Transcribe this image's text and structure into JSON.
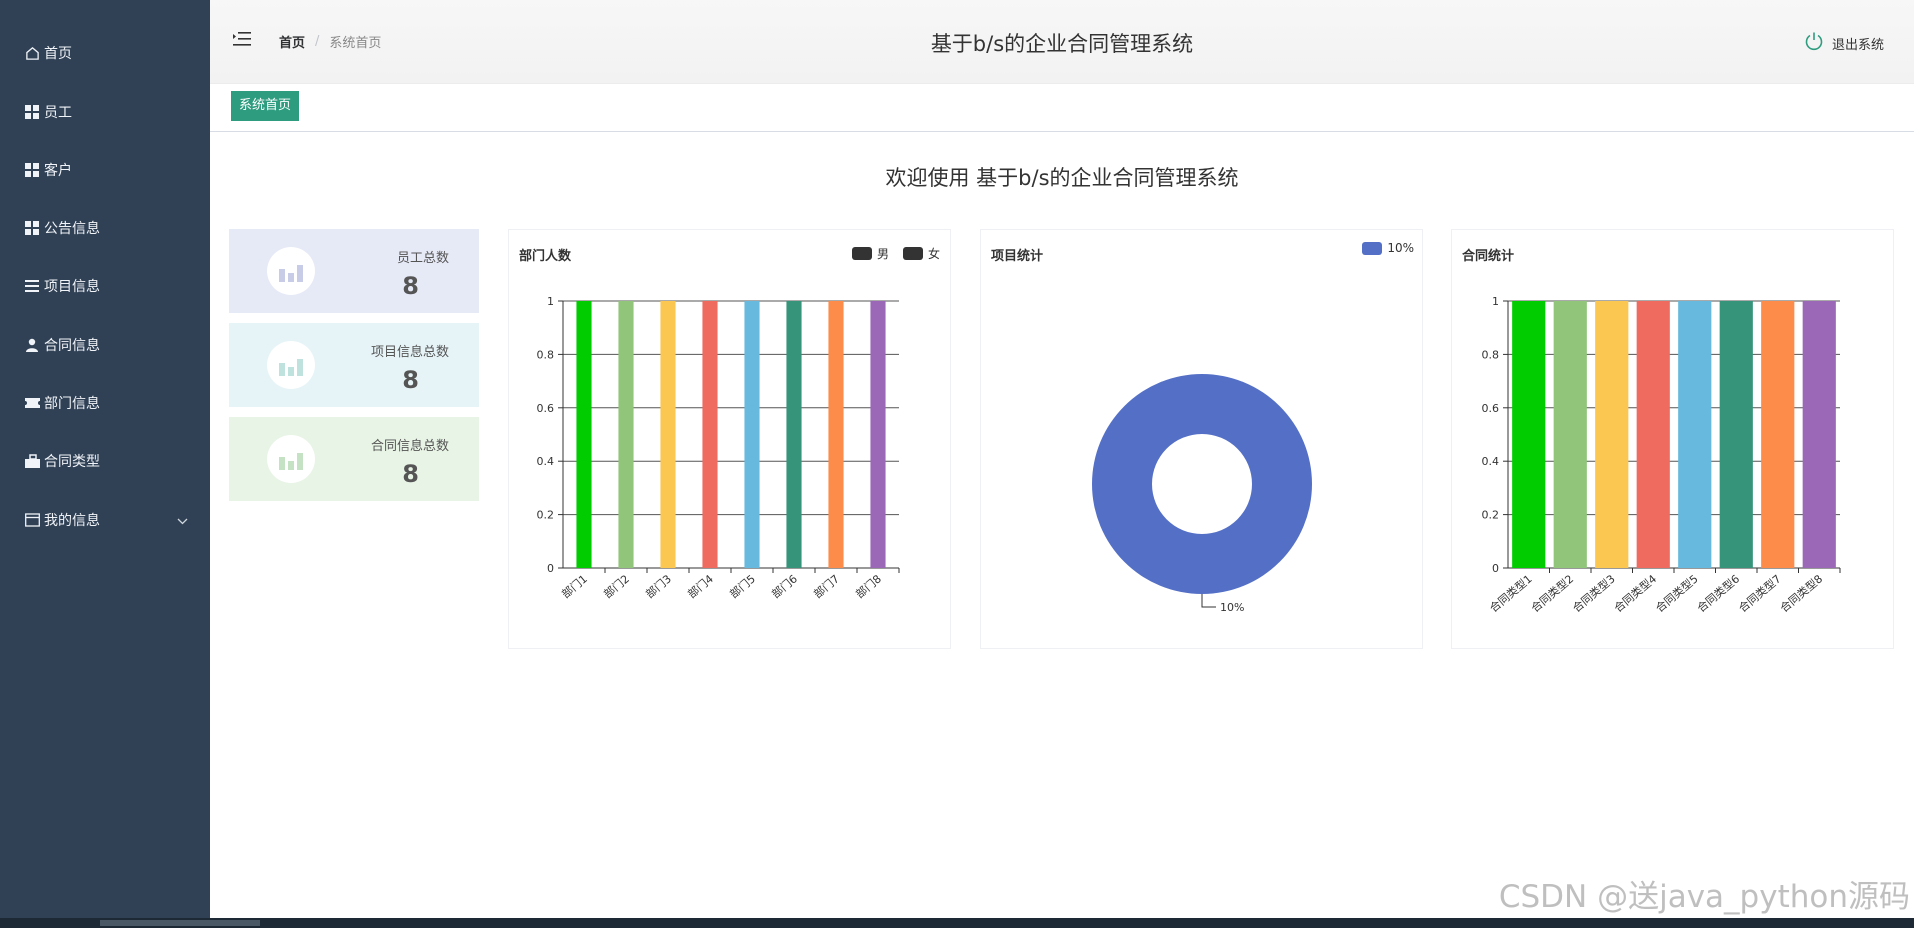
{
  "sidebar": {
    "items": [
      {
        "label": "首页",
        "icon": "home-icon"
      },
      {
        "label": "员工",
        "icon": "grid-icon"
      },
      {
        "label": "客户",
        "icon": "grid-icon"
      },
      {
        "label": "公告信息",
        "icon": "grid-icon"
      },
      {
        "label": "项目信息",
        "icon": "list-icon"
      },
      {
        "label": "合同信息",
        "icon": "user-icon"
      },
      {
        "label": "部门信息",
        "icon": "ticket-icon"
      },
      {
        "label": "合同类型",
        "icon": "briefcase-icon"
      },
      {
        "label": "我的信息",
        "icon": "window-icon"
      }
    ]
  },
  "header": {
    "breadcrumb": [
      "首页",
      "系统首页"
    ],
    "title": "基于b/s的企业合同管理系统",
    "logout_label": "退出系统"
  },
  "tags": {
    "active": "系统首页"
  },
  "welcome": "欢迎使用 基于b/s的企业合同管理系统",
  "stats": [
    {
      "label": "员工总数",
      "value": "8",
      "bg": "#e6e9f6"
    },
    {
      "label": "项目信息总数",
      "value": "8",
      "bg": "#e6f4f8"
    },
    {
      "label": "合同信息总数",
      "value": "8",
      "bg": "#e8f4e6"
    }
  ],
  "colors": {
    "sidebar_bg": "#304156",
    "accent": "#2e9c7f",
    "palette": [
      "#00cc00",
      "#91c57a",
      "#fcc751",
      "#ef6b5f",
      "#67b9de",
      "#35947a",
      "#fd8b4a",
      "#9b68b8"
    ]
  },
  "chart_data": [
    {
      "type": "bar",
      "title": "部门人数",
      "categories": [
        "部门1",
        "部门2",
        "部门3",
        "部门4",
        "部门5",
        "部门6",
        "部门7",
        "部门8"
      ],
      "series": [
        {
          "name": "男",
          "values": [
            1,
            1,
            1,
            1,
            1,
            1,
            1,
            1
          ]
        }
      ],
      "legend": [
        "男",
        "女"
      ],
      "legend_color": "#333333",
      "yticks": [
        "0",
        "0.2",
        "0.4",
        "0.6",
        "0.8",
        "1"
      ],
      "ylim": [
        0,
        1
      ]
    },
    {
      "type": "pie",
      "title": "项目统计",
      "slices": [
        {
          "label": "10%",
          "value": 1,
          "color": "#5470c6"
        }
      ],
      "legend": [
        "10%"
      ],
      "donut": true
    },
    {
      "type": "bar",
      "title": "合同统计",
      "categories": [
        "合同类型1",
        "合同类型2",
        "合同类型3",
        "合同类型4",
        "合同类型5",
        "合同类型6",
        "合同类型7",
        "合同类型8"
      ],
      "values": [
        1,
        1,
        1,
        1,
        1,
        1,
        1,
        1
      ],
      "yticks": [
        "0",
        "0.2",
        "0.4",
        "0.6",
        "0.8",
        "1"
      ],
      "ylim": [
        0,
        1
      ]
    }
  ],
  "watermark": "CSDN @送java_python源码"
}
